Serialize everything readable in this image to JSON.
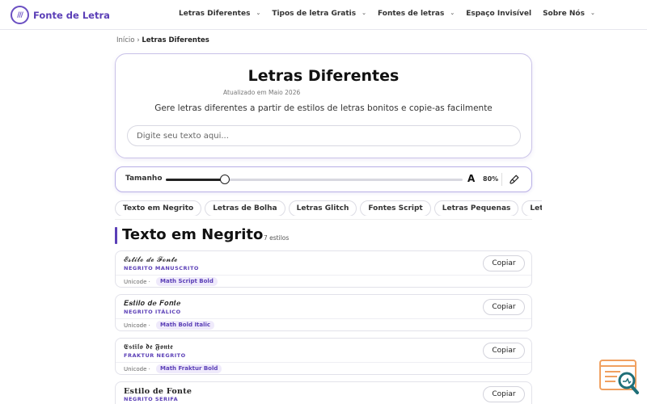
{
  "brand": {
    "name": "Fonte de Letra",
    "logo_glyph": "///"
  },
  "nav": [
    {
      "label": "Letras Diferentes",
      "has_menu": true
    },
    {
      "label": "Tipos de letra Gratis",
      "has_menu": true
    },
    {
      "label": "Fontes de letras",
      "has_menu": true
    },
    {
      "label": "Espaço Invisível",
      "has_menu": false
    },
    {
      "label": "Sobre Nós",
      "has_menu": true
    }
  ],
  "breadcrumb": {
    "home": "Início",
    "separator": "›",
    "current": "Letras Diferentes"
  },
  "hero": {
    "title": "Letras Diferentes",
    "updated": "Atualizado em Maio 2026",
    "subtitle": "Gere letras diferentes a partir de estilos de letras bonitos e copie-as facilmente",
    "input_placeholder": "Digite seu texto aqui..."
  },
  "size_control": {
    "label": "Tamanho",
    "letter": "A",
    "value_text": "80%",
    "slider_fraction": 0.2
  },
  "chips": [
    "Texto em Negrito",
    "Letras de Bolha",
    "Letras Glitch",
    "Fontes Script",
    "Letras Pequenas",
    "Letras Ci"
  ],
  "section": {
    "title": "Texto em Negrito",
    "count": "7 estilos"
  },
  "styles": [
    {
      "sample": "𝓔𝓼𝓽𝓲𝓵𝓸 𝓭𝓮 𝓕𝓸𝓷𝓽𝓮",
      "name": "NEGRITO MANUSCRITO",
      "meta": "Unicode ·",
      "tag": "Math Script Bold",
      "copy": "Copiar"
    },
    {
      "sample": "𝑬𝒔𝒕𝒊𝒍𝒐 𝒅𝒆 𝑭𝒐𝒏𝒕𝒆",
      "name": "NEGRITO ITÁLICO",
      "meta": "Unicode ·",
      "tag": "Math Bold Italic",
      "copy": "Copiar"
    },
    {
      "sample": "𝕰𝖘𝖙𝖎𝖑𝖔 𝖉𝖊 𝕱𝖔𝖓𝖙𝖊",
      "name": "FRAKTUR NEGRITO",
      "meta": "Unicode ·",
      "tag": "Math Fraktur Bold",
      "copy": "Copiar"
    },
    {
      "sample": "Estilo de Fonte",
      "name": "NEGRITO SERIFA",
      "meta": "",
      "tag": "",
      "copy": "Copiar"
    }
  ],
  "colors": {
    "accent": "#5b3fb7",
    "accent_light": "#efeafb",
    "widget_orange": "#f0a060",
    "widget_teal": "#1f6f78"
  },
  "icons": {
    "logo": "slashes-logo-icon",
    "brush": "brush-icon",
    "chevron": "chevron-down-icon",
    "widget": "search-document-icon"
  }
}
